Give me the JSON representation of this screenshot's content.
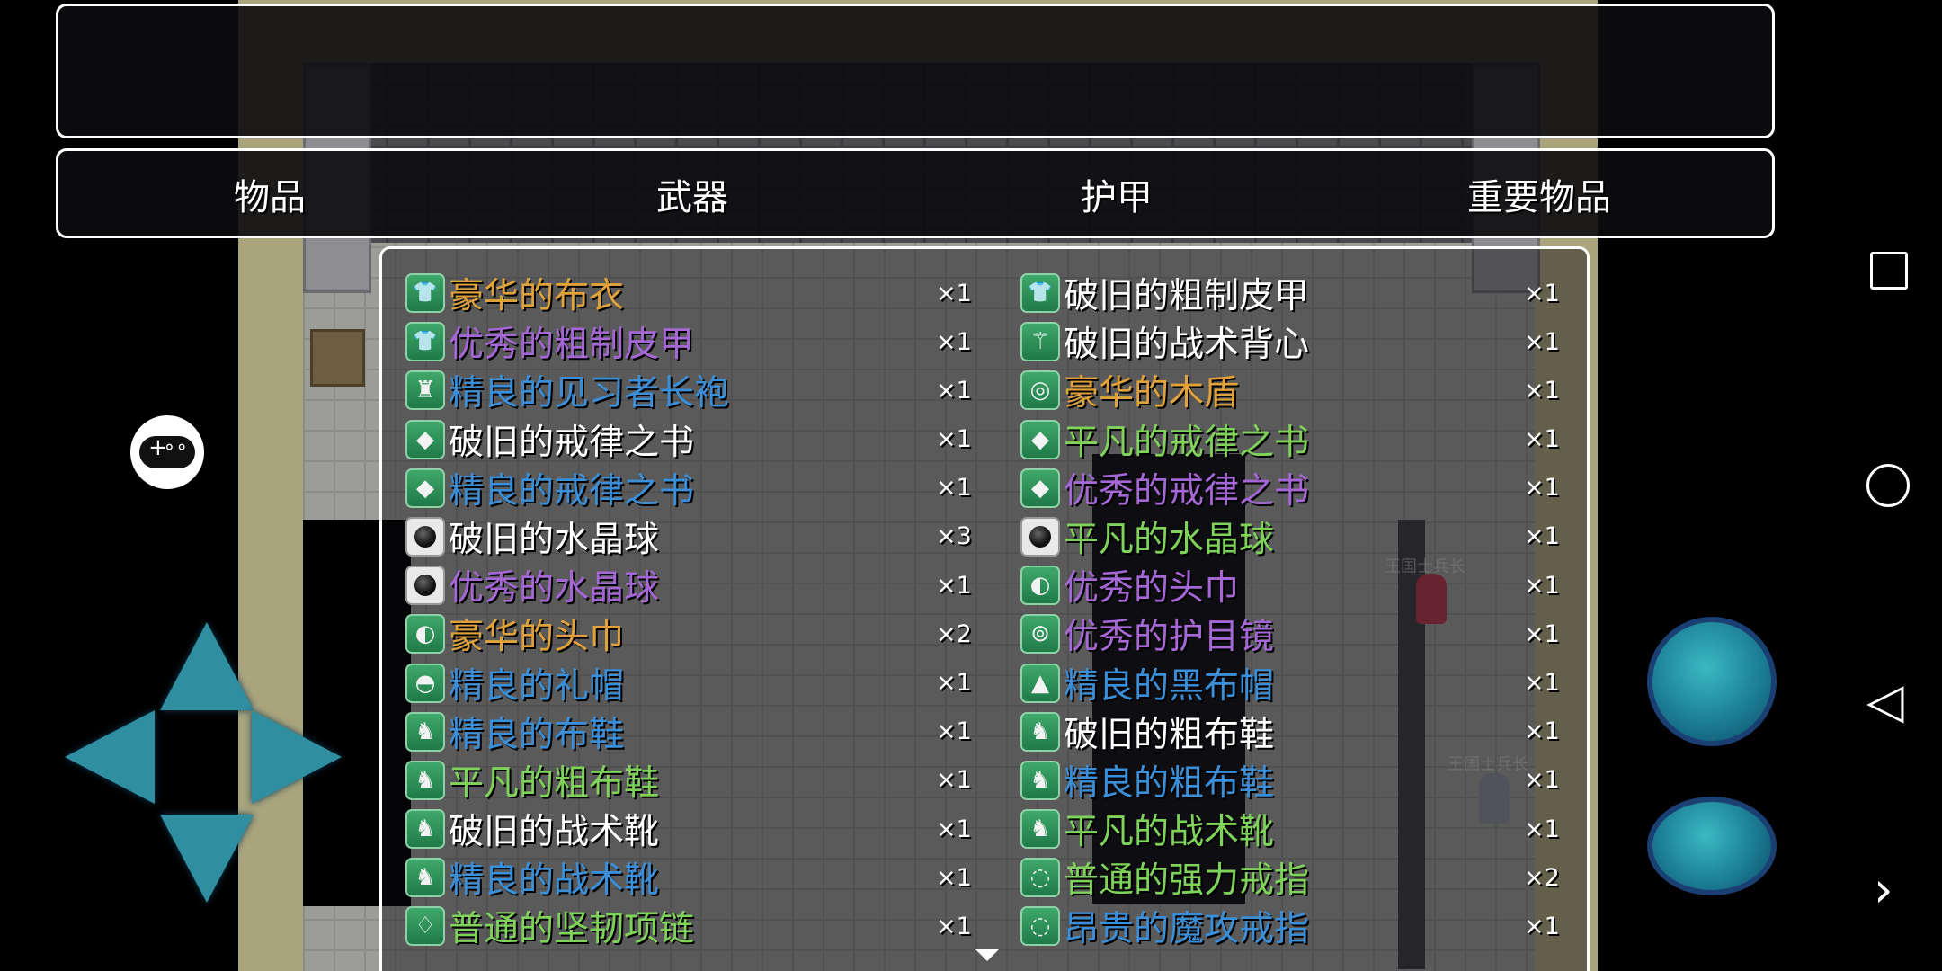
{
  "tabs": [
    "物品",
    "武器",
    "护甲",
    "重要物品"
  ],
  "selected_tab": 2,
  "items_left": [
    {
      "name": "豪华的布衣",
      "qty": "×1",
      "rarity": "rich",
      "icon": "shirt-icon"
    },
    {
      "name": "优秀的粗制皮甲",
      "qty": "×1",
      "rarity": "good",
      "icon": "shirt-icon"
    },
    {
      "name": "精良的见习者长袍",
      "qty": "×1",
      "rarity": "fine",
      "icon": "robe-icon"
    },
    {
      "name": "破旧的戒律之书",
      "qty": "×1",
      "rarity": "plain",
      "icon": "book-icon"
    },
    {
      "name": "精良的戒律之书",
      "qty": "×1",
      "rarity": "fine",
      "icon": "book-icon"
    },
    {
      "name": "破旧的水晶球",
      "qty": "×3",
      "rarity": "plain",
      "icon": "orb-icon"
    },
    {
      "name": "优秀的水晶球",
      "qty": "×1",
      "rarity": "good",
      "icon": "orb-icon"
    },
    {
      "name": "豪华的头巾",
      "qty": "×2",
      "rarity": "rich",
      "icon": "headband-icon"
    },
    {
      "name": "精良的礼帽",
      "qty": "×1",
      "rarity": "fine",
      "icon": "hat-icon"
    },
    {
      "name": "精良的布鞋",
      "qty": "×1",
      "rarity": "fine",
      "icon": "boot-icon"
    },
    {
      "name": "平凡的粗布鞋",
      "qty": "×1",
      "rarity": "common",
      "icon": "boot-icon"
    },
    {
      "name": "破旧的战术靴",
      "qty": "×1",
      "rarity": "plain",
      "icon": "boot-icon"
    },
    {
      "name": "精良的战术靴",
      "qty": "×1",
      "rarity": "fine",
      "icon": "boot-icon"
    },
    {
      "name": "普通的坚韧项链",
      "qty": "×1",
      "rarity": "common",
      "icon": "necklace-icon"
    }
  ],
  "items_right": [
    {
      "name": "破旧的粗制皮甲",
      "qty": "×1",
      "rarity": "plain",
      "icon": "shirt-icon"
    },
    {
      "name": "破旧的战术背心",
      "qty": "×1",
      "rarity": "plain",
      "icon": "vest-icon"
    },
    {
      "name": "豪华的木盾",
      "qty": "×1",
      "rarity": "rich",
      "icon": "shield-icon"
    },
    {
      "name": "平凡的戒律之书",
      "qty": "×1",
      "rarity": "common",
      "icon": "book-icon"
    },
    {
      "name": "优秀的戒律之书",
      "qty": "×1",
      "rarity": "good",
      "icon": "book-icon"
    },
    {
      "name": "平凡的水晶球",
      "qty": "×1",
      "rarity": "common",
      "icon": "orb-icon"
    },
    {
      "name": "优秀的头巾",
      "qty": "×1",
      "rarity": "good",
      "icon": "headband-icon"
    },
    {
      "name": "优秀的护目镜",
      "qty": "×1",
      "rarity": "good",
      "icon": "goggles-icon"
    },
    {
      "name": "精良的黑布帽",
      "qty": "×1",
      "rarity": "fine",
      "icon": "witch-hat-icon"
    },
    {
      "name": "破旧的粗布鞋",
      "qty": "×1",
      "rarity": "plain",
      "icon": "boot-icon"
    },
    {
      "name": "精良的粗布鞋",
      "qty": "×1",
      "rarity": "fine",
      "icon": "boot-icon"
    },
    {
      "name": "平凡的战术靴",
      "qty": "×1",
      "rarity": "common",
      "icon": "boot-icon"
    },
    {
      "name": "普通的强力戒指",
      "qty": "×2",
      "rarity": "common",
      "icon": "ring-icon"
    },
    {
      "name": "昂贵的魔攻戒指",
      "qty": "×1",
      "rarity": "fine",
      "icon": "ring-icon"
    }
  ],
  "npc_labels": [
    "王国士兵长",
    "王国士兵长"
  ],
  "colors": {
    "plain": "#ffffff",
    "common": "#7fd35a",
    "fine": "#3a8fd8",
    "good": "#a667d6",
    "rich": "#e0a23a",
    "tab_highlight": "#96d2be"
  }
}
